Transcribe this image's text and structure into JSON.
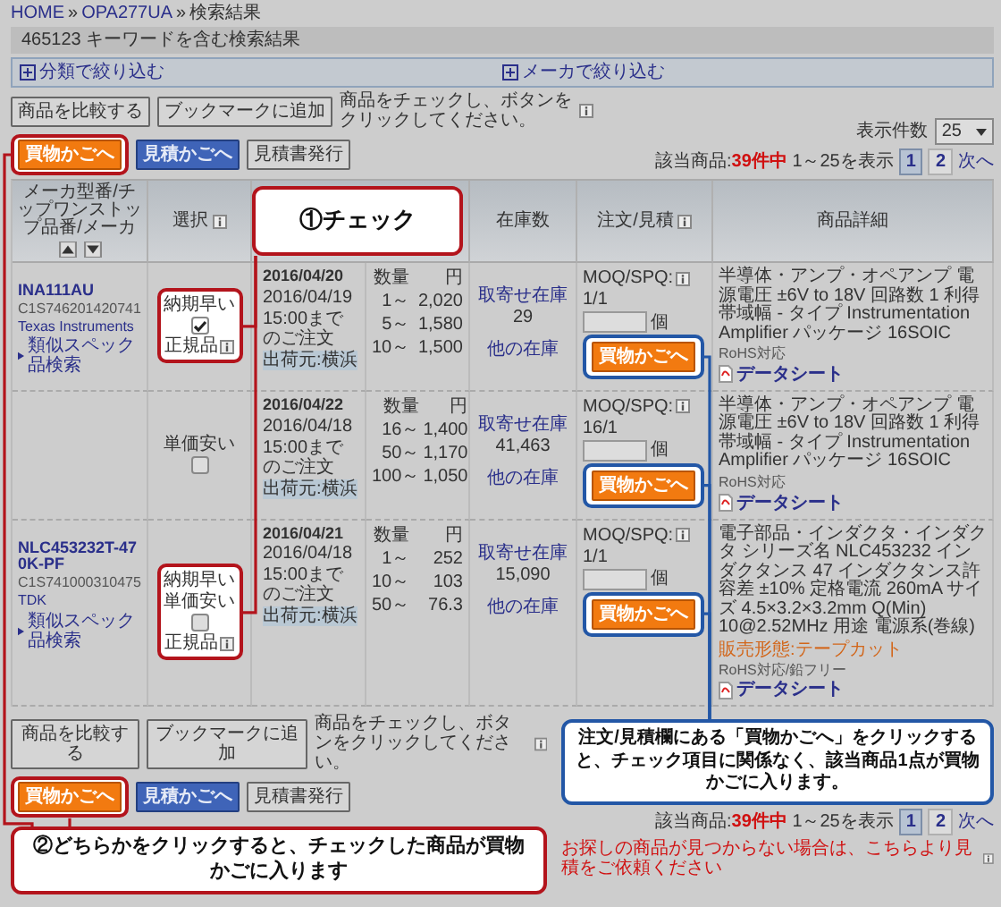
{
  "breadcrumb": {
    "items": [
      "HOME",
      "OPA277UA",
      "検索結果"
    ],
    "separator": "»"
  },
  "search_title": "465123 キーワードを含む検索結果",
  "filters": [
    {
      "label": "分類で絞り込む",
      "expanded": false
    },
    {
      "label": "メーカで絞り込む",
      "expanded": false
    }
  ],
  "per_page": {
    "label": "表示件数",
    "value": "25"
  },
  "toolbars": [
    {
      "compare": "商品を比較する",
      "bookmark": "ブックマークに追加",
      "note": "商品をチェックし、ボタンをクリックしてください。",
      "buttons": [
        {
          "label": "買物かごへ",
          "kind": "cart",
          "highlighted": true
        },
        {
          "label": "見積かごへ",
          "kind": "quote",
          "highlighted": false
        },
        {
          "label": "見積書発行",
          "kind": "plain",
          "highlighted": false
        }
      ]
    },
    {
      "compare": "商品を比較する",
      "bookmark": "ブックマークに追加",
      "note": "商品をチェックし、ボタンをクリックしてください。",
      "buttons": [
        {
          "label": "買物かごへ",
          "kind": "cart",
          "highlighted": true
        },
        {
          "label": "見積かごへ",
          "kind": "quote",
          "highlighted": false
        },
        {
          "label": "見積書発行",
          "kind": "plain",
          "highlighted": false
        }
      ]
    }
  ],
  "result_counts": [
    {
      "label": "該当商品:",
      "total": "39件中",
      "range": "1～25を表示",
      "pages": [
        {
          "label": "1",
          "selected": true
        },
        {
          "label": "2",
          "selected": false
        }
      ],
      "next": "次へ"
    },
    {
      "label": "該当商品:",
      "total": "39件中",
      "range": "1～25を表示",
      "pages": [
        {
          "label": "1",
          "selected": true
        },
        {
          "label": "2",
          "selected": false
        }
      ],
      "next": "次へ"
    }
  ],
  "table": {
    "columns": [
      "メーカ型番/チップワンストップ品番/メーカ",
      "選択",
      "在庫数",
      "注文/見積",
      "商品詳細"
    ],
    "rows": [
      {
        "part": {
          "number": "INA111AU",
          "code": "C1S746201420741",
          "maker": "Texas Instruments",
          "similar": "類似スペック品検索"
        },
        "select": {
          "tags": [
            "納期早い"
          ],
          "checked": true,
          "genuine": "正規品",
          "highlighted": true
        },
        "delivery": {
          "date": "2016/04/20",
          "cutoff_date": "2016/04/19",
          "cutoff": "15:00までのご注文",
          "ship_from": "出荷元:横浜"
        },
        "prices": {
          "qty_label": "数量",
          "unit": "円",
          "tiers": [
            {
              "qty": "1～",
              "price": "2,020"
            },
            {
              "qty": "5～",
              "price": "1,580"
            },
            {
              "qty": "10～",
              "price": "1,500"
            }
          ]
        },
        "stock": {
          "label": "取寄せ在庫",
          "count": "29",
          "other": "他の在庫"
        },
        "order": {
          "moq_label": "MOQ/SPQ:",
          "moq": "1/1",
          "unit": "個",
          "button": "買物かごへ",
          "highlighted": true
        },
        "detail": {
          "text": "半導体・アンプ・オペアンプ 電源電圧 ±6V to 18V 回路数 1 利得帯域幅 - タイプ Instrumentation Amplifier パッケージ 16SOIC",
          "rohs": "RoHS対応",
          "datasheet": "データシート"
        }
      },
      {
        "select": {
          "tags": [
            "単価安い"
          ],
          "checked": false,
          "highlighted": false
        },
        "delivery": {
          "date": "2016/04/22",
          "cutoff_date": "2016/04/18",
          "cutoff": "15:00までのご注文",
          "ship_from": "出荷元:横浜"
        },
        "prices": {
          "qty_label": "数量",
          "unit": "円",
          "tiers": [
            {
              "qty": "16～",
              "price": "1,400"
            },
            {
              "qty": "50～",
              "price": "1,170"
            },
            {
              "qty": "100～",
              "price": "1,050"
            }
          ]
        },
        "stock": {
          "label": "取寄せ在庫",
          "count": "41,463",
          "other": "他の在庫"
        },
        "order": {
          "moq_label": "MOQ/SPQ:",
          "moq": "16/1",
          "unit": "個",
          "button": "買物かごへ",
          "highlighted": true
        },
        "detail": {
          "text": "半導体・アンプ・オペアンプ 電源電圧 ±6V to 18V 回路数 1 利得帯域幅 - タイプ Instrumentation Amplifier パッケージ 16SOIC",
          "rohs": "RoHS対応",
          "datasheet": "データシート"
        }
      },
      {
        "part": {
          "number": "NLC453232T-470K-PF",
          "code": "C1S741000310475",
          "maker": "TDK",
          "similar": "類似スペック品検索"
        },
        "select": {
          "tags": [
            "納期早い",
            "単価安い"
          ],
          "checked": false,
          "genuine": "正規品",
          "highlighted": true
        },
        "delivery": {
          "date": "2016/04/21",
          "cutoff_date": "2016/04/18",
          "cutoff": "15:00までのご注文",
          "ship_from": "出荷元:横浜"
        },
        "prices": {
          "qty_label": "数量",
          "unit": "円",
          "tiers": [
            {
              "qty": "1～",
              "price": "252"
            },
            {
              "qty": "10～",
              "price": "103"
            },
            {
              "qty": "50～",
              "price": "76.3"
            }
          ]
        },
        "stock": {
          "label": "取寄せ在庫",
          "count": "15,090",
          "other": "他の在庫"
        },
        "order": {
          "moq_label": "MOQ/SPQ:",
          "moq": "1/1",
          "unit": "個",
          "button": "買物かごへ",
          "highlighted": true
        },
        "detail": {
          "text": "電子部品・インダクタ・インダクタ シリーズ名 NLC453232 インダクタンス 47 インダクタンス許容差 ±10% 定格電流 260mA サイズ 4.5×3.2×3.2mm Q(Min) 10@2.52MHz 用途 電源系(巻線)",
          "sales_form": "販売形態:テープカット",
          "rohs": "RoHS対応/鉛フリー",
          "datasheet": "データシート"
        }
      }
    ]
  },
  "quote_request": "お探しの商品が見つからない場合は、こちらより見積をご依頼ください",
  "annotations": [
    {
      "text": "①チェック",
      "color": "#b3141c"
    },
    {
      "text": "②どちらかをクリックすると、チェックした商品が買物かごに入ります",
      "color": "#b3141c"
    },
    {
      "text": "注文/見積欄にある「買物かごへ」をクリックすると、チェック項目に関係なく、該当商品1点が買物かごに入ります。",
      "color": "#2357a6"
    }
  ]
}
